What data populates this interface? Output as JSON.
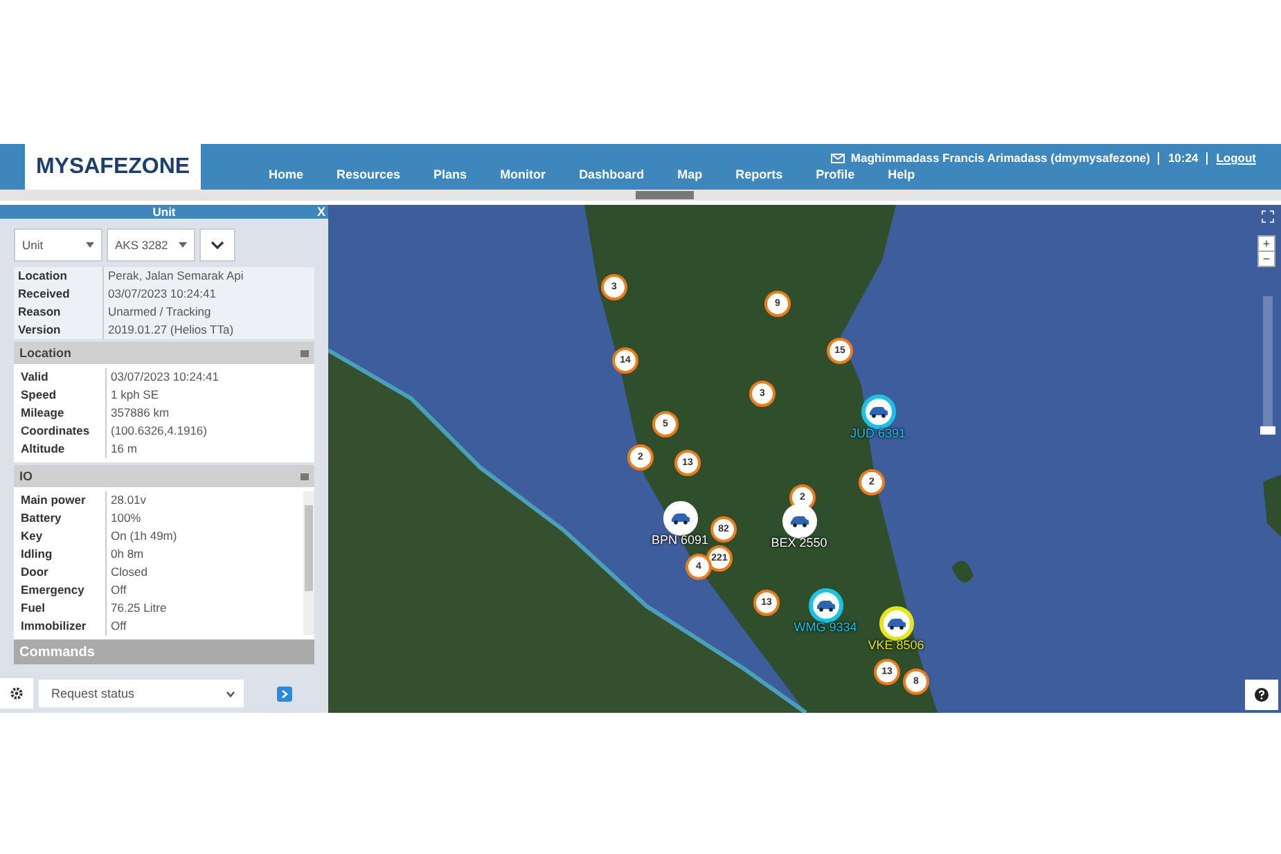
{
  "header": {
    "logo": "MYSAFEZONE",
    "nav": [
      "Home",
      "Resources",
      "Plans",
      "Monitor",
      "Dashboard",
      "Map",
      "Reports",
      "Profile",
      "Help"
    ],
    "user": "Maghimmadass Francis Arimadass (dmymysafezone)",
    "time": "10:24",
    "logout": "Logout"
  },
  "unit_panel": {
    "title": "Unit",
    "close": "X",
    "unit_type": "Unit",
    "unit": "AKS 3282",
    "summary": [
      {
        "label": "Location",
        "value": "Perak, Jalan Semarak Api"
      },
      {
        "label": "Received",
        "value": "03/07/2023 10:24:41"
      },
      {
        "label": "Reason",
        "value": "Unarmed / Tracking"
      },
      {
        "label": "Version",
        "value": "2019.01.27 (Helios TTa)"
      }
    ],
    "sections": [
      {
        "title": "Location",
        "rows": [
          {
            "label": "Valid",
            "value": "03/07/2023 10:24:41"
          },
          {
            "label": "Speed",
            "value": "1 kph SE"
          },
          {
            "label": "Mileage",
            "value": "357886 km"
          },
          {
            "label": "Coordinates",
            "value": "(100.6326,4.1916)"
          },
          {
            "label": "Altitude",
            "value": "16 m"
          }
        ]
      },
      {
        "title": "IO",
        "rows": [
          {
            "label": "Main power",
            "value": "28.01v"
          },
          {
            "label": "Battery",
            "value": "100%"
          },
          {
            "label": "Key",
            "value": "On (1h 49m)"
          },
          {
            "label": "Idling",
            "value": "0h 8m"
          },
          {
            "label": "Door",
            "value": "Closed"
          },
          {
            "label": "Emergency",
            "value": "Off"
          },
          {
            "label": "Fuel",
            "value": "76.25 Litre"
          },
          {
            "label": "Immobilizer",
            "value": "Off"
          }
        ]
      }
    ],
    "commands": {
      "title": "Commands",
      "command": "Request status"
    }
  },
  "map": {
    "clusters": [
      "3",
      "9",
      "14",
      "15",
      "3",
      "5",
      "2",
      "13",
      "2",
      "2",
      "82",
      "221",
      "4",
      "13",
      "13",
      "8"
    ],
    "vehicles": [
      {
        "plate": "JUD 6391",
        "color": "#19c3e6"
      },
      {
        "plate": "BPN 6091",
        "color": "#ffffff"
      },
      {
        "plate": "BEX 2550",
        "color": "#ffffff"
      },
      {
        "plate": "WMG 9334",
        "color": "#19c3e6"
      },
      {
        "plate": "VKE 8506",
        "color": "#e6e619"
      }
    ],
    "zoom_in": "+",
    "zoom_out": "−"
  }
}
